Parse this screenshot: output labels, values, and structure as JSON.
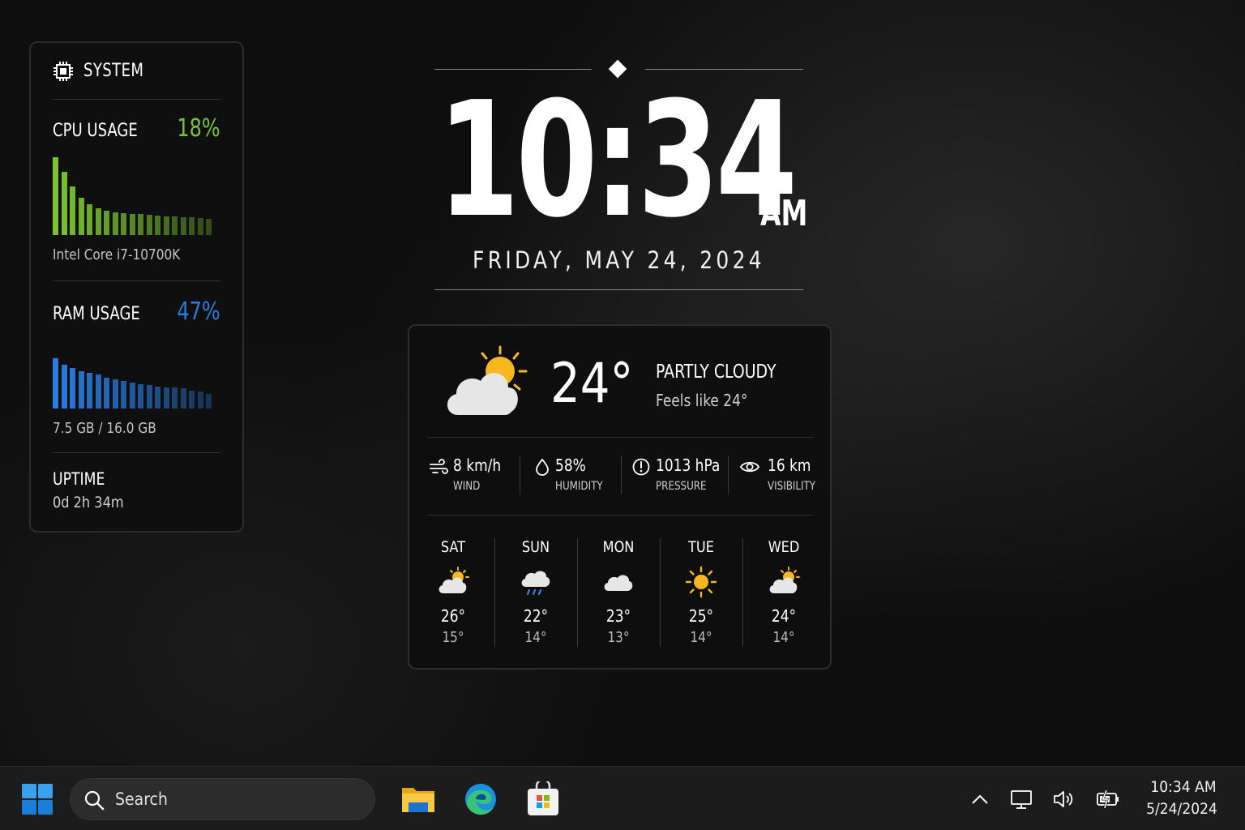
{
  "system": {
    "title": "SYSTEM",
    "cpu": {
      "label": "CPU USAGE",
      "value": "18%",
      "model": "Intel Core i7-10700K",
      "color": "#7cc332",
      "history": [
        0.96,
        0.78,
        0.6,
        0.46,
        0.38,
        0.33,
        0.3,
        0.28,
        0.27,
        0.26,
        0.26,
        0.25,
        0.24,
        0.23,
        0.23,
        0.22,
        0.22,
        0.21,
        0.2
      ]
    },
    "ram": {
      "label": "RAM USAGE",
      "value": "47%",
      "detail": "7.5 GB / 16.0 GB",
      "color": "#2a7de1",
      "history": [
        0.78,
        0.67,
        0.62,
        0.58,
        0.55,
        0.52,
        0.48,
        0.45,
        0.42,
        0.4,
        0.38,
        0.36,
        0.34,
        0.33,
        0.32,
        0.31,
        0.28,
        0.26,
        0.22
      ]
    },
    "uptime": {
      "label": "UPTIME",
      "value": "0d 2h 34m"
    }
  },
  "clock": {
    "time": "10:34",
    "ampm": "AM",
    "date": "FRIDAY, MAY 24, 2024"
  },
  "weather": {
    "current": {
      "temp": "24°",
      "condition": "PARTLY CLOUDY",
      "feels_like": "Feels like 24°",
      "icon": "partly-cloudy-icon"
    },
    "stats": [
      {
        "icon": "wind-icon",
        "value": "8 km/h",
        "label": "WIND"
      },
      {
        "icon": "humidity-icon",
        "value": "58%",
        "label": "HUMIDITY"
      },
      {
        "icon": "pressure-icon",
        "value": "1013 hPa",
        "label": "PRESSURE"
      },
      {
        "icon": "visibility-icon",
        "value": "16 km",
        "label": "VISIBILITY"
      }
    ],
    "forecast": [
      {
        "day": "SAT",
        "icon": "partly-cloudy-icon",
        "hi": "26°",
        "lo": "15°"
      },
      {
        "day": "SUN",
        "icon": "rain-icon",
        "hi": "22°",
        "lo": "14°"
      },
      {
        "day": "MON",
        "icon": "cloudy-icon",
        "hi": "23°",
        "lo": "13°"
      },
      {
        "day": "TUE",
        "icon": "sunny-icon",
        "hi": "25°",
        "lo": "14°"
      },
      {
        "day": "WED",
        "icon": "partly-cloudy-icon",
        "hi": "24°",
        "lo": "14°"
      }
    ]
  },
  "taskbar": {
    "search_placeholder": "Search",
    "apps": [
      "file-explorer-icon",
      "edge-icon",
      "store-icon"
    ],
    "tray": {
      "time": "10:34 AM",
      "date": "5/24/2024"
    }
  }
}
